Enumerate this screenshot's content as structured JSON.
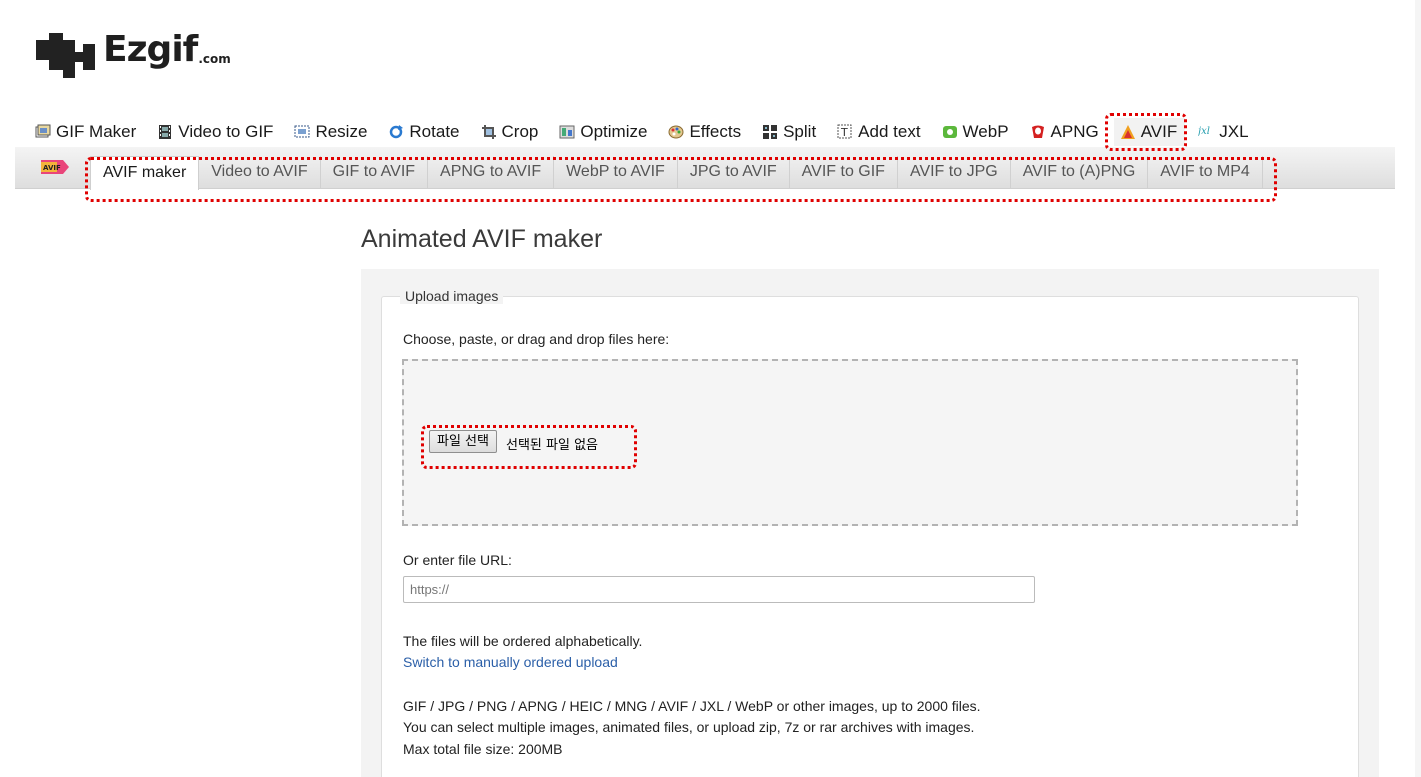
{
  "brand": {
    "name": "Ezgif",
    "suffix": ".com"
  },
  "mainnav": {
    "items": [
      {
        "label": "GIF Maker",
        "icon": "gif-maker-icon"
      },
      {
        "label": "Video to GIF",
        "icon": "film-icon"
      },
      {
        "label": "Resize",
        "icon": "resize-icon"
      },
      {
        "label": "Rotate",
        "icon": "rotate-icon"
      },
      {
        "label": "Crop",
        "icon": "crop-icon"
      },
      {
        "label": "Optimize",
        "icon": "optimize-icon"
      },
      {
        "label": "Effects",
        "icon": "palette-icon"
      },
      {
        "label": "Split",
        "icon": "split-icon"
      },
      {
        "label": "Add text",
        "icon": "add-text-icon"
      },
      {
        "label": "WebP",
        "icon": "webp-icon"
      },
      {
        "label": "APNG",
        "icon": "apng-icon"
      },
      {
        "label": "AVIF",
        "icon": "avif-icon",
        "active": true
      },
      {
        "label": "JXL",
        "icon": "jxl-icon"
      }
    ]
  },
  "subnav": {
    "badge_icon": "avif-logo-icon",
    "tabs": [
      {
        "label": "AVIF maker",
        "active": true
      },
      {
        "label": "Video to AVIF"
      },
      {
        "label": "GIF to AVIF"
      },
      {
        "label": "APNG to AVIF"
      },
      {
        "label": "WebP to AVIF"
      },
      {
        "label": "JPG to AVIF"
      },
      {
        "label": "AVIF to GIF"
      },
      {
        "label": "AVIF to JPG"
      },
      {
        "label": "AVIF to (A)PNG"
      },
      {
        "label": "AVIF to MP4"
      }
    ]
  },
  "main": {
    "title": "Animated AVIF maker",
    "upload": {
      "legend": "Upload images",
      "choose_label": "Choose, paste, or drag and drop files here:",
      "file_button": "파일 선택",
      "file_status": "선택된 파일 없음",
      "url_label": "Or enter file URL:",
      "url_placeholder": "https://",
      "order_note": "The files will be ordered alphabetically.",
      "switch_link": "Switch to manually ordered upload",
      "info_line1": "GIF / JPG / PNG / APNG / HEIC / MNG / AVIF / JXL / WebP or other images, up to 2000 files.",
      "info_line2": "You can select multiple images, animated files, or upload zip, 7z or rar archives with images.",
      "info_line3": "Max total file size: 200MB"
    }
  },
  "colors": {
    "annotation": "#e00000",
    "link": "#2b5fa8",
    "panel_bg": "#f3f3f3"
  }
}
